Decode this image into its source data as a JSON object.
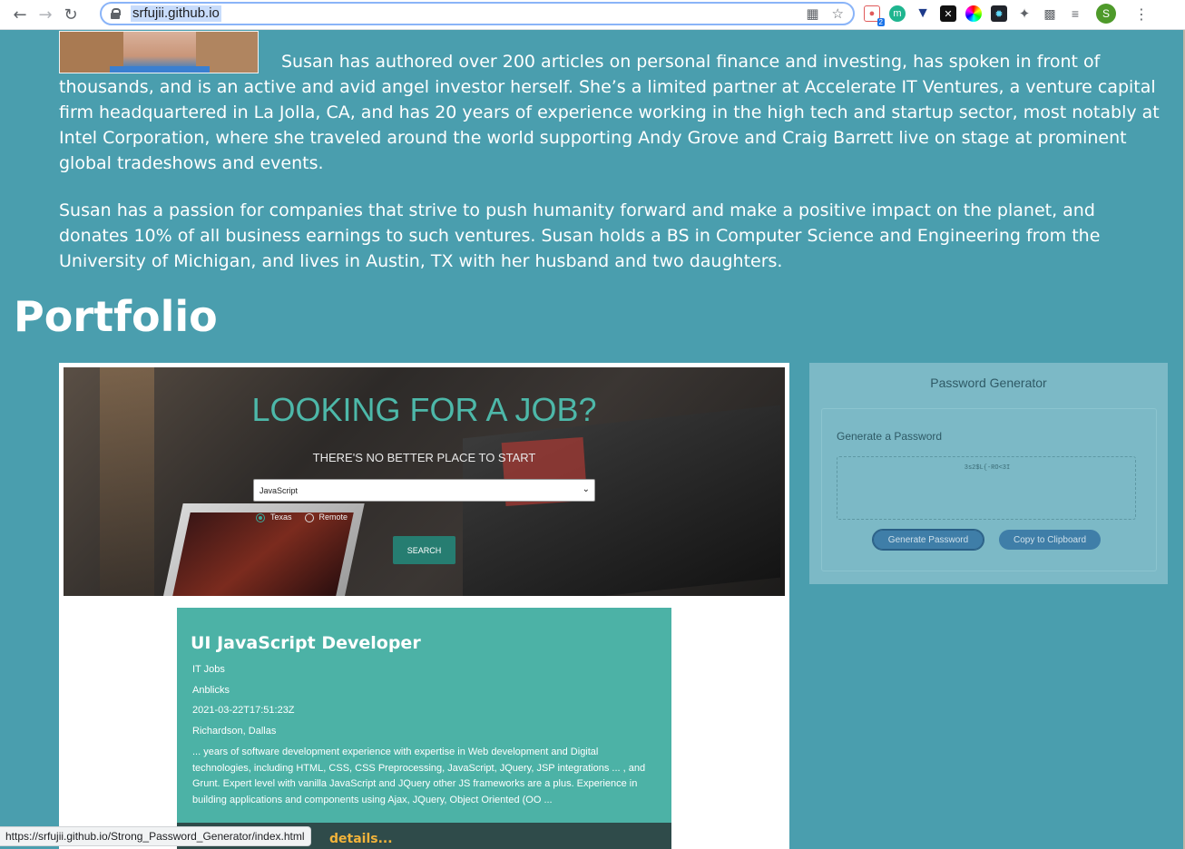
{
  "browser": {
    "url": "srfujii.github.io",
    "status_url": "https://srfujii.github.io/Strong_Password_Generator/index.html",
    "extension_badge": "2",
    "profile_initial": "S"
  },
  "bio": {
    "paragraph1": "Susan has authored over 200 articles on personal finance and investing, has spoken in front of thousands, and is an active and avid angel investor herself. She’s a limited partner at Accelerate IT Ventures, a venture capital firm headquartered in La Jolla, CA, and has 20 years of experience working in the high tech and startup sector, most notably at Intel Corporation, where she traveled around the world supporting Andy Grove and Craig Barrett live on stage at prominent global tradeshows and events.",
    "paragraph2": "Susan has a passion for companies that strive to push humanity forward and make a positive impact on the planet, and donates 10% of all business earnings to such ventures. Susan holds a BS in Computer Science and Engineering from the University of Michigan, and lives in Austin, TX with her husband and two daughters."
  },
  "portfolio": {
    "title": "Portfolio"
  },
  "job_finder": {
    "hero_title": "LOOKING FOR A JOB?",
    "hero_subtitle": "THERE'S NO BETTER PLACE TO START",
    "select_value": "JavaScript",
    "radio_texas": "Texas",
    "radio_remote": "Remote",
    "radio_selected": "Texas",
    "search_label": "SEARCH",
    "job": {
      "title": "UI JavaScript Developer",
      "category": "IT Jobs",
      "company": "Anblicks",
      "posted": "2021-03-22T17:51:23Z",
      "location": "Richardson, Dallas",
      "description": "... years of software development experience with expertise in Web development and Digital technologies, including HTML, CSS, CSS Preprocessing, JavaScript, JQuery, JSP integrations ... , and Grunt. Expert level with vanilla JavaScript and JQuery other JS frameworks are a plus. Experience in building applications and components using Ajax, JQuery, Object Oriented (OO ...",
      "details_link": "details..."
    }
  },
  "password_generator": {
    "title": "Password Generator",
    "subtitle": "Generate a Password",
    "generated_password": "3s2$L{-RO<3I",
    "generate_button": "Generate Password",
    "copy_button": "Copy to Clipboard"
  },
  "colors": {
    "page_background": "#4a9eae",
    "job_card": "#4cb2a6",
    "hero_title": "#4db8a9",
    "details_link": "#f2b33a",
    "pw_card": "#7cb9c6",
    "pw_button": "#3f7ea8"
  }
}
